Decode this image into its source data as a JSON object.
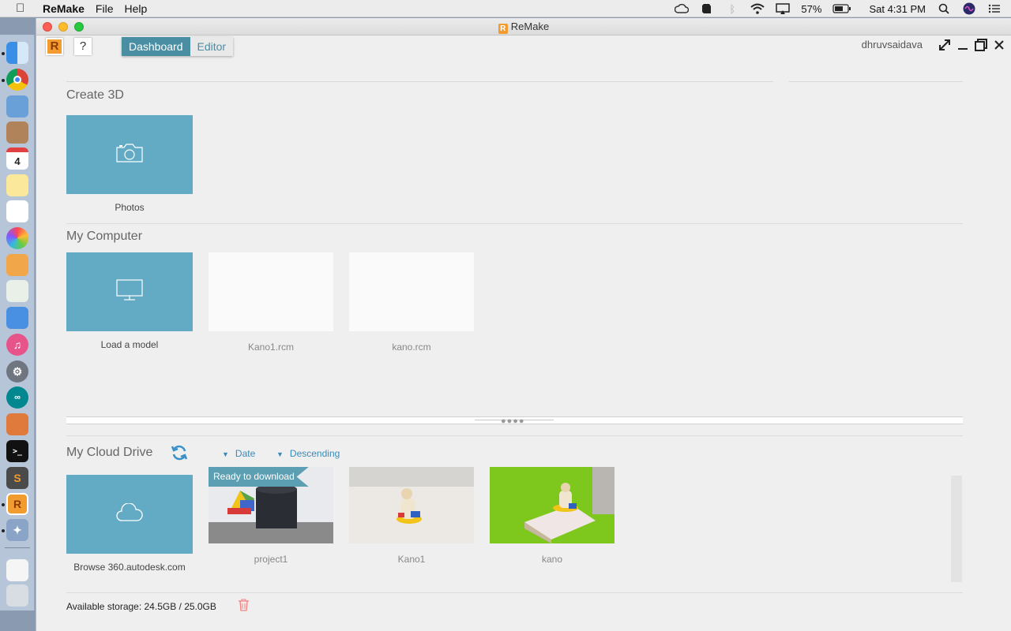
{
  "menubar": {
    "app_name": "ReMake",
    "menus": [
      "File",
      "Help"
    ],
    "battery": "57%",
    "clock": "Sat 4:31 PM"
  },
  "window": {
    "title": "ReMake",
    "tabs": {
      "dashboard": "Dashboard",
      "editor": "Editor"
    },
    "help_label": "?",
    "username": "dhruvsaidava"
  },
  "create3d": {
    "title": "Create 3D",
    "photos_label": "Photos"
  },
  "my_computer": {
    "title": "My Computer",
    "load_label": "Load a model",
    "files": [
      "Kano1.rcm",
      "kano.rcm"
    ]
  },
  "cloud": {
    "title": "My Cloud Drive",
    "sort_field": "Date",
    "sort_order": "Descending",
    "browse_label": "Browse 360.autodesk.com",
    "projects": [
      {
        "name": "project1",
        "badge": "Ready to download"
      },
      {
        "name": "Kano1"
      },
      {
        "name": "kano"
      }
    ]
  },
  "footer": {
    "storage": "Available storage: 24.5GB / 25.0GB"
  },
  "colors": {
    "tile": "#63abc4",
    "tab_active": "#4a8ea4",
    "accent": "#3a8ab8",
    "badge": "#5c9fb2"
  }
}
